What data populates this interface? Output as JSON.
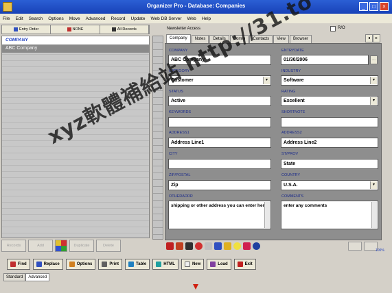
{
  "window": {
    "title": "Organizer Pro - Database: Companies"
  },
  "menu": [
    "File",
    "Edit",
    "Search",
    "Options",
    "Move",
    "Advanced",
    "Record",
    "Update",
    "Web DB Server",
    "Web",
    "Help"
  ],
  "left_toolbar": {
    "entry_order": "Entry Order",
    "none": "NONE",
    "all_records": "All Records"
  },
  "left_list": {
    "header": "COMPANY",
    "rows": [
      "ABC Company"
    ]
  },
  "right_panel": {
    "label": "Newsletter Access",
    "checkbox_label": "R/O",
    "tabs": [
      "Company",
      "Notes",
      "Details",
      "Comm",
      "Contacts",
      "View",
      "Browser"
    ]
  },
  "form": {
    "company_label": "COMPANY",
    "company_value": "ABC Company",
    "entrydate_label": "ENTRYDATE",
    "entrydate_value": "01/30/2006",
    "category_label": "CATEGORY",
    "category_value": "Customer",
    "industry_label": "INDUSTRY",
    "industry_value": "Software",
    "status_label": "STATUS",
    "status_value": "Active",
    "rating_label": "RATING",
    "rating_value": "Excellent",
    "keywords_label": "KEYWORDS",
    "keywords_value": "",
    "shortnote_label": "SHORTNOTE",
    "shortnote_value": "",
    "address1_label": "ADDRESS1",
    "address1_value": "Address Line1",
    "address2_label": "ADDRESS2",
    "address2_value": "Address Line2",
    "city_label": "CITY",
    "city_value": "",
    "state_label": "ST/PROV",
    "state_value": "State",
    "zip_label": "ZIP/POSTAL",
    "zip_value": "Zip",
    "country_label": "COUNTRY",
    "country_value": "U.S.A.",
    "otheraddr_label": "OTHERADDR",
    "otheraddr_value": "shipping or other address you can enter here",
    "comments_label": "COMMENTS",
    "comments_value": "enter any comments"
  },
  "left_bottom": {
    "btn1": "Records",
    "btn2": "Add",
    "btn3": "Duplicate",
    "btn4": "Delete"
  },
  "zoom": "100%",
  "bottom_toolbar": [
    "Find",
    "Replace",
    "Options",
    "Print",
    "Table",
    "HTML",
    "New",
    "Load",
    "Exit"
  ],
  "status_tabs": [
    "Standard",
    "Advanced"
  ],
  "watermark": "xyz軟體補給站 http://31.to"
}
